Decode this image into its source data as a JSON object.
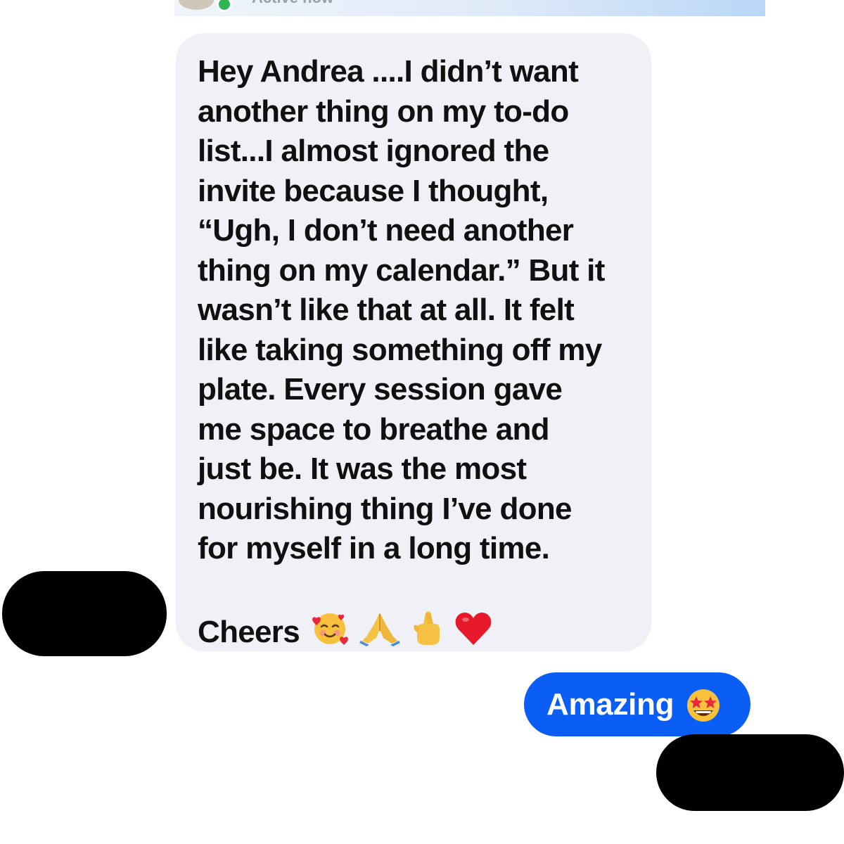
{
  "header": {
    "status_text": "Active now"
  },
  "message_in": {
    "lines": [
      "Hey Andrea ....I didn’t want",
      "another thing on my to-do",
      "list...I almost ignored the",
      "invite because I thought,",
      "“Ugh, I don’t need another",
      "thing on my calendar.” But it",
      "wasn’t like that at all. It felt",
      "like taking something off my",
      "plate. Every session gave",
      "me space to breathe and",
      "just be. It was the most",
      "nourishing thing I’ve done",
      "for myself in a long time."
    ],
    "signoff": "Cheers",
    "signoff_emojis": [
      "smiling-face-with-hearts",
      "folded-hands",
      "crossed-fingers",
      "red-heart"
    ]
  },
  "message_out": {
    "text": "Amazing",
    "emoji": "star-struck"
  },
  "colors": {
    "incoming_bubble": "#f0f1f6",
    "outgoing_bubble": "#0a5df5",
    "active_dot": "#31b454",
    "redaction": "#000000"
  }
}
